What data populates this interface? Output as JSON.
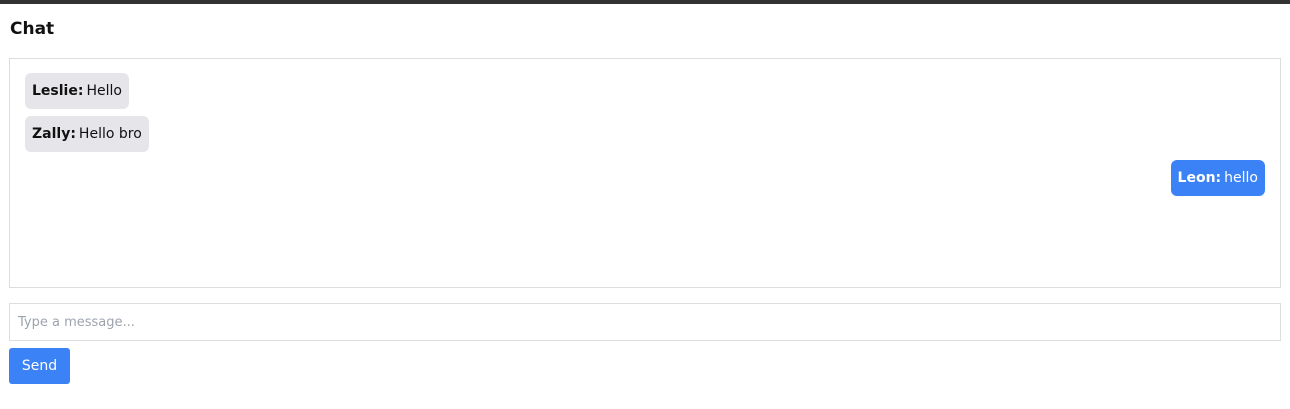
{
  "header": {
    "title": "Chat"
  },
  "messages": [
    {
      "sender": "Leslie:",
      "text": "Hello",
      "side": "other"
    },
    {
      "sender": "Zally:",
      "text": "Hello bro",
      "side": "other"
    },
    {
      "sender": "Leon:",
      "text": "hello",
      "side": "mine"
    }
  ],
  "composer": {
    "input_value": "",
    "placeholder": "Type a message...",
    "send_label": "Send"
  },
  "colors": {
    "top_bar": "#333333",
    "own_bubble": "#3b82f6",
    "other_bubble": "#e5e5ea",
    "send_button": "#3b82f6"
  }
}
